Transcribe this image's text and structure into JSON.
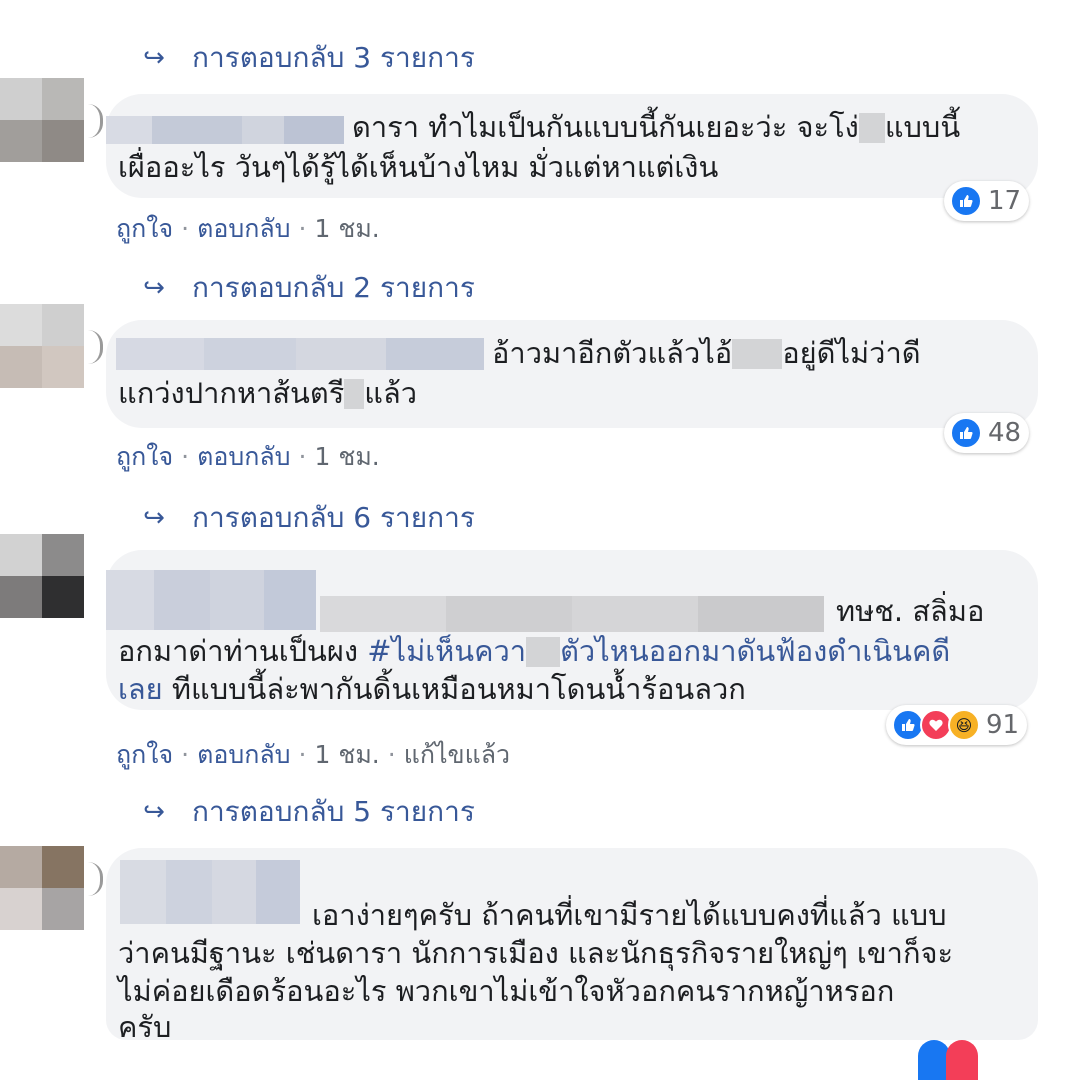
{
  "comments": [
    {
      "replies_label": "การตอบกลับ 3 รายการ",
      "text_lines": [
        "ดารา ทำไมเป็นกันแบบนี้กันเยอะว่ะ จะโง่",
        "แบบนี้",
        "เผื่ออะไร วันๆได้รู้ได้เห็นบ้างไหม มั่วแต่หาแต่เงิน"
      ],
      "reaction_count": "17",
      "like_label": "ถูกใจ",
      "reply_label": "ตอบกลับ",
      "time": "1 ชม."
    },
    {
      "replies_label": "การตอบกลับ 2 รายการ",
      "text_lines": [
        "อ้าวมาอีกตัวแล้วไอ้",
        "อยู่ดีไม่ว่าดี",
        "แกว่งปากหาส้นตรี",
        "แล้ว"
      ],
      "reaction_count": "48",
      "like_label": "ถูกใจ",
      "reply_label": "ตอบกลับ",
      "time": "1 ชม."
    },
    {
      "replies_label": "การตอบกลับ 6 รายการ",
      "text_lines": [
        "ทษช. สลิ่มอ",
        "อกมาด่าท่านเป็นผง",
        "#ไม่เห็นควา",
        "ตัวไหนออกมาดันฟ้องดำเนินคดี",
        "เลย",
        "ทีแบบนี้ล่ะพากันดิ้นเหมือนหมาโดนน้ำร้อนลวก"
      ],
      "reaction_count": "91",
      "like_label": "ถูกใจ",
      "reply_label": "ตอบกลับ",
      "time": "1 ชม.",
      "edited_label": "แก้ไขแล้ว"
    },
    {
      "replies_label": "การตอบกลับ 5 รายการ",
      "text_lines": [
        "เอาง่ายๆครับ ถ้าคนที่เขามีรายได้แบบคงที่แล้ว แบบ",
        "ว่าคนมีฐานะ เช่นดารา นักการเมือง และนักธุรกิจรายใหญ่ๆ เขาก็จะ",
        "ไม่ค่อยเดือดร้อนอะไร พวกเขาไม่เข้าใจหัวอกคนรากหญ้าหรอก",
        "ครับ"
      ]
    }
  ],
  "icons": {
    "reply_arrow": "reply-arrow-icon",
    "like": "like-reaction-icon",
    "love": "love-reaction-icon",
    "haha": "haha-reaction-icon"
  },
  "colors": {
    "link": "#385898",
    "bubble": "#f2f3f5",
    "like_blue": "#1877f2",
    "love_red": "#f33e58",
    "haha_yellow": "#f7b125"
  }
}
